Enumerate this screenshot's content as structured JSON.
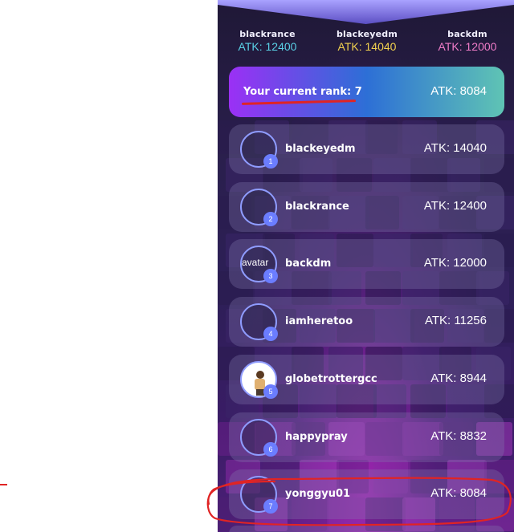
{
  "podium": [
    {
      "name": "blackrance",
      "atk": "ATK: 12400",
      "color": "#5ad1e6"
    },
    {
      "name": "blackeyedm",
      "atk": "ATK: 14040",
      "color": "#f3d24f"
    },
    {
      "name": "backdm",
      "atk": "ATK: 12000",
      "color": "#f07cc8"
    }
  ],
  "current_rank": {
    "label": "Your current rank: 7",
    "atk": "ATK: 8084"
  },
  "leaderboard": [
    {
      "rank": "1",
      "name": "blackeyedm",
      "atk": "ATK: 14040",
      "avatar_icon": "empty-avatar-icon"
    },
    {
      "rank": "2",
      "name": "blackrance",
      "atk": "ATK: 12400",
      "avatar_icon": "empty-avatar-icon"
    },
    {
      "rank": "3",
      "name": "backdm",
      "atk": "ATK: 12000",
      "avatar_icon": "broken-image-icon",
      "avatar_alt": "avatar"
    },
    {
      "rank": "4",
      "name": "iamheretoo",
      "atk": "ATK: 11256",
      "avatar_icon": "empty-avatar-icon"
    },
    {
      "rank": "5",
      "name": "globetrottergcc",
      "atk": "ATK: 8944",
      "avatar_icon": "photo-avatar-icon"
    },
    {
      "rank": "6",
      "name": "happypray",
      "atk": "ATK: 8832",
      "avatar_icon": "empty-avatar-icon"
    },
    {
      "rank": "7",
      "name": "yonggyu01",
      "atk": "ATK: 8084",
      "avatar_icon": "empty-avatar-icon"
    }
  ],
  "colors": {
    "annotation_red": "#e02424",
    "badge": "#6b7dff",
    "current_rank_gradient": [
      "#9b30f5",
      "#2d6fd6",
      "#5fc4b4"
    ]
  }
}
